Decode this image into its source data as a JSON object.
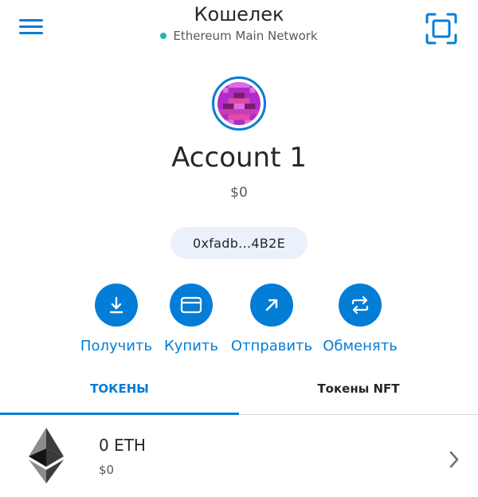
{
  "header": {
    "title": "Кошелек",
    "network": "Ethereum Main Network",
    "network_status_color": "#29b6af"
  },
  "account": {
    "name": "Account 1",
    "fiat_balance": "$0",
    "address": "0xfadb...4B2E"
  },
  "actions": [
    {
      "label": "Получить",
      "icon": "download-icon"
    },
    {
      "label": "Купить",
      "icon": "card-icon"
    },
    {
      "label": "Отправить",
      "icon": "arrow-up-right-icon"
    },
    {
      "label": "Обменять",
      "icon": "swap-icon"
    }
  ],
  "tabs": [
    {
      "label": "ТОКЕНЫ",
      "active": true
    },
    {
      "label": "Токены NFT",
      "active": false
    }
  ],
  "tokens": [
    {
      "amount": "0 ETH",
      "fiat": "$0",
      "icon": "ethereum-icon"
    }
  ],
  "colors": {
    "accent": "#037dd6",
    "address_pill_bg": "#eaf1fa",
    "text": "#24272a",
    "muted": "#535a61"
  }
}
